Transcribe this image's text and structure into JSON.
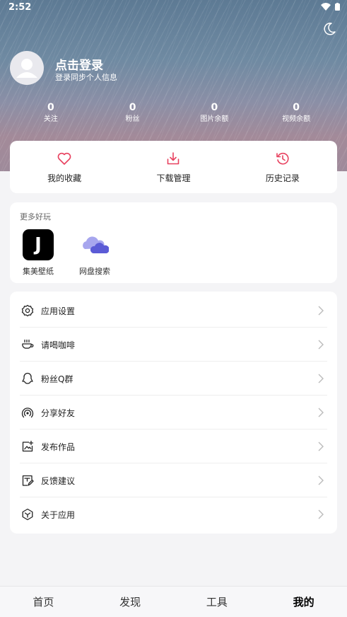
{
  "status_bar": {
    "time": "2:52"
  },
  "profile": {
    "title": "点击登录",
    "subtitle": "登录同步个人信息"
  },
  "stats": [
    {
      "value": "0",
      "label": "关注"
    },
    {
      "value": "0",
      "label": "粉丝"
    },
    {
      "value": "0",
      "label": "图片余额"
    },
    {
      "value": "0",
      "label": "视频余额"
    }
  ],
  "actions": [
    {
      "label": "我的收藏",
      "icon": "heart-icon"
    },
    {
      "label": "下载管理",
      "icon": "download-icon"
    },
    {
      "label": "历史记录",
      "icon": "history-icon"
    }
  ],
  "more": {
    "title": "更多好玩",
    "apps": [
      {
        "label": "集美壁纸",
        "icon": "jimei-wallpaper-icon",
        "glyph": "J"
      },
      {
        "label": "网盘搜索",
        "icon": "cloud-icon"
      }
    ]
  },
  "settings": [
    {
      "label": "应用设置",
      "icon": "gear-icon"
    },
    {
      "label": "请喝咖啡",
      "icon": "coffee-cup-icon"
    },
    {
      "label": "粉丝Q群",
      "icon": "qq-icon"
    },
    {
      "label": "分享好友",
      "icon": "share-signal-icon"
    },
    {
      "label": "发布作品",
      "icon": "publish-image-icon"
    },
    {
      "label": "反馈建议",
      "icon": "feedback-icon"
    },
    {
      "label": "关于应用",
      "icon": "about-cube-icon"
    }
  ],
  "bottom_nav": [
    {
      "label": "首页",
      "active": false
    },
    {
      "label": "发现",
      "active": false
    },
    {
      "label": "工具",
      "active": false
    },
    {
      "label": "我的",
      "active": true
    }
  ],
  "colors": {
    "accent": "#e8415f",
    "cloud_front": "#5b5bd6",
    "cloud_back": "#a7a6ee"
  }
}
